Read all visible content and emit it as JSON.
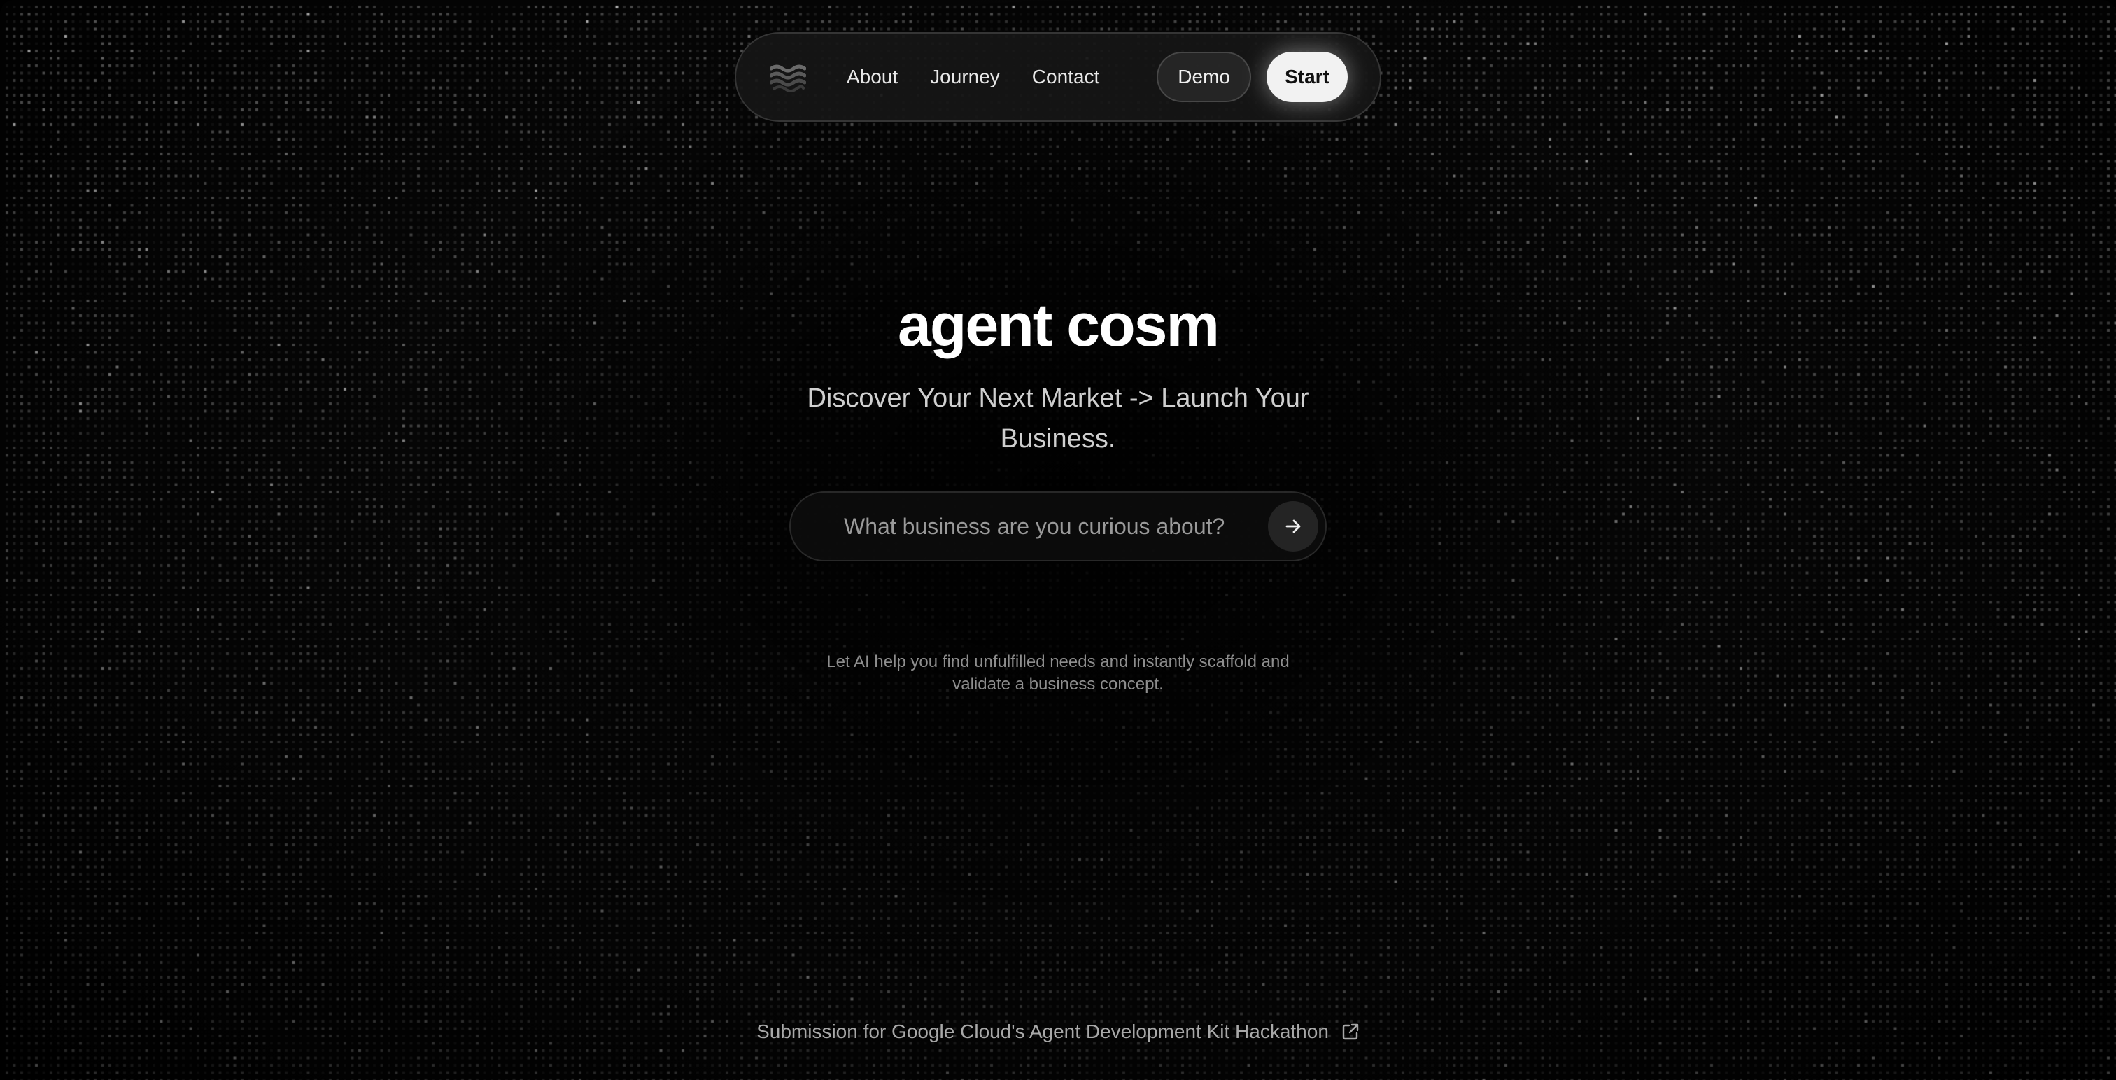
{
  "nav": {
    "logo_icon": "wave-logo-icon",
    "links": [
      {
        "label": "About"
      },
      {
        "label": "Journey"
      },
      {
        "label": "Contact"
      }
    ],
    "demo_label": "Demo",
    "start_label": "Start"
  },
  "hero": {
    "title": "agent cosm",
    "subtitle": "Discover Your Next Market -> Launch Your Business.",
    "search_placeholder": "What business are you curious about?",
    "search_submit_icon": "arrow-right-icon",
    "note": "Let AI help you find unfulfilled needs and instantly scaffold and validate a business concept."
  },
  "footer": {
    "link_text": "Submission for Google Cloud's Agent Development Kit Hackathon",
    "link_icon": "external-link-icon"
  },
  "colors": {
    "background": "#000000",
    "accent_button": "#f2f2f2",
    "text_primary": "#ffffff",
    "text_muted": "#8e8e8e"
  }
}
